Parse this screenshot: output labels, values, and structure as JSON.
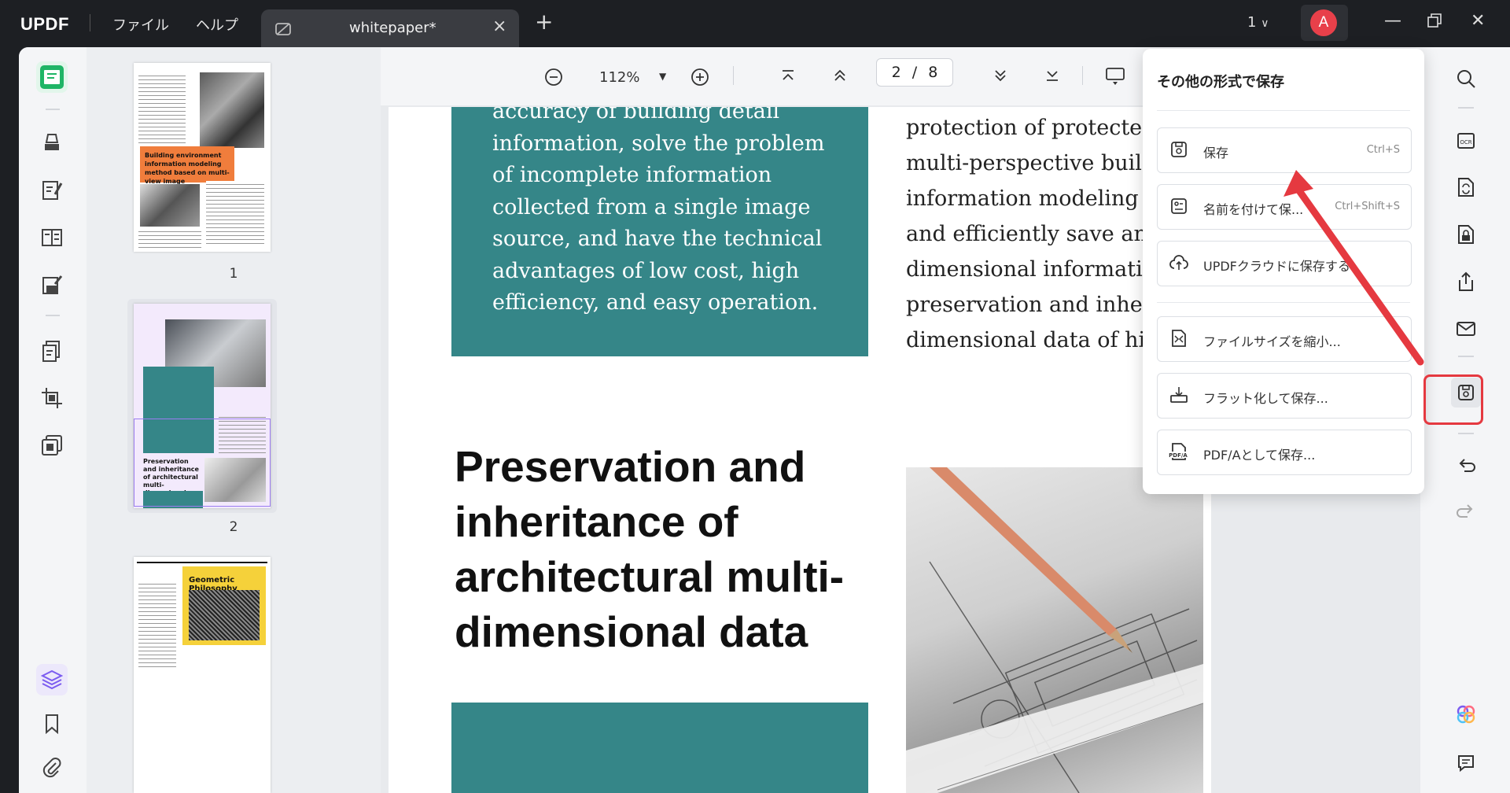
{
  "app": {
    "logo": "UPDF"
  },
  "menu": {
    "file": "ファイル",
    "help": "ヘルプ"
  },
  "tab": {
    "title": "whitepaper*"
  },
  "titlebar": {
    "page_selector": "1",
    "avatar_letter": "A"
  },
  "toolbar": {
    "zoom": "112%",
    "page_current": "2",
    "page_sep": "/",
    "page_total": "8"
  },
  "thumbnails": {
    "numbers": [
      "1",
      "2"
    ],
    "page1_banner": "Building environment information modeling method based on multi-view image",
    "page2_heading": "Preservation and inheritance of architectural multi-dimensional data",
    "page3_banner": "Geometric Philosophy"
  },
  "document": {
    "teal_lines": [
      "accuracy of building detail",
      "information, solve the problem",
      "of incomplete information",
      "collected from a single image",
      "source, and have the technical",
      "advantages of low cost, high",
      "efficiency, and easy operation."
    ],
    "right_lines": [
      "protection of protected b",
      "multi-perspective buildi",
      "information modeling m",
      "and efficiently save and",
      "dimensional information",
      "preservation and inherit",
      "dimensional data of hist"
    ],
    "heading_lines": [
      "Preservation and",
      "inheritance of",
      "architectural multi-",
      "dimensional data"
    ]
  },
  "save_popup": {
    "title": "その他の形式で保存",
    "items": [
      {
        "label": "保存",
        "shortcut": "Ctrl+S"
      },
      {
        "label": "名前を付けて保...",
        "shortcut": "Ctrl+Shift+S"
      },
      {
        "label": "UPDFクラウドに保存する",
        "shortcut": ""
      },
      {
        "label": "ファイルサイズを縮小...",
        "shortcut": ""
      },
      {
        "label": "フラット化して保存...",
        "shortcut": ""
      },
      {
        "label": "PDF/Aとして保存...",
        "shortcut": ""
      }
    ]
  },
  "colors": {
    "accent_teal": "#358688",
    "highlight_red": "#e53940",
    "active_green": "#1fb566"
  }
}
